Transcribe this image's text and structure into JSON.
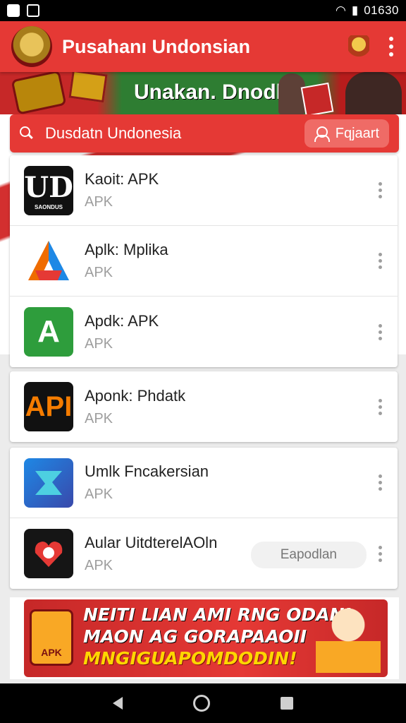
{
  "status_bar": {
    "time": "01630"
  },
  "app_bar": {
    "title": "Pusahanı Undonsian"
  },
  "banner": {
    "text": "Unakan. Dnodks"
  },
  "search": {
    "placeholder": "Dusdatn Undonesia",
    "button_label": "Fqjaart"
  },
  "apps": [
    {
      "name": "Kaoit: APK",
      "subtitle": "APK",
      "icon_text": "UD",
      "icon_sub": "SAONDUS"
    },
    {
      "name": "Aplk: Mplika",
      "subtitle": "APK"
    },
    {
      "name": "Apdk: APK",
      "subtitle": "APK",
      "icon_text": "A"
    },
    {
      "name": "Aponk: Phdatk",
      "subtitle": "APK",
      "icon_text": "API"
    },
    {
      "name": "Umlk Fncakersian",
      "subtitle": "APK"
    },
    {
      "name": "Aular UitdterelAOln",
      "subtitle": "APK",
      "pill_label": "Eapodlan"
    }
  ],
  "ad": {
    "line1": "NEITI LIAN AMI RNG ODANI",
    "line2": "MAON AG GORAPAAOII",
    "line3": "MNGIGUAPOMDODIN!",
    "logo_text": "APK"
  },
  "colors": {
    "primary": "#e53935",
    "green": "#2e7d32"
  }
}
